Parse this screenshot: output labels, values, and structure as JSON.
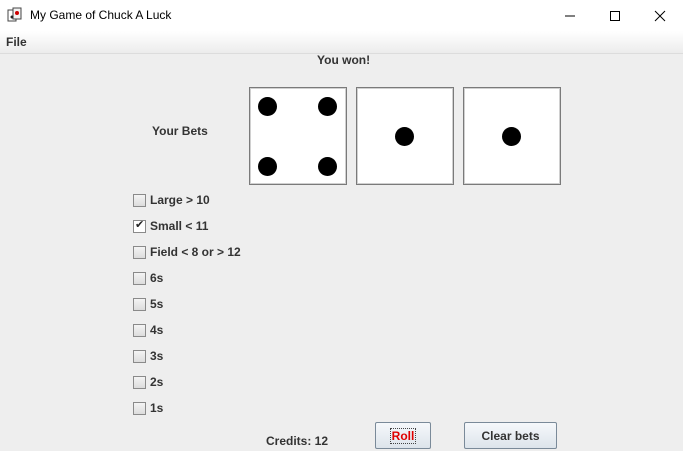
{
  "window": {
    "title": "My Game of Chuck A Luck",
    "app_icon": "chuck-a-luck-icon",
    "controls": [
      "minimize-icon",
      "maximize-icon",
      "close-icon"
    ]
  },
  "menu": {
    "file_label": "File"
  },
  "game": {
    "status": "You won!",
    "bets_label": "Your Bets",
    "dice": [
      4,
      1,
      1
    ],
    "credits_text": "Credits: 12"
  },
  "bets": [
    {
      "label": "Large > 10",
      "checked": false
    },
    {
      "label": "Small < 11",
      "checked": true
    },
    {
      "label": "Field < 8 or > 12",
      "checked": false
    },
    {
      "label": "6s",
      "checked": false
    },
    {
      "label": "5s",
      "checked": false
    },
    {
      "label": "4s",
      "checked": false
    },
    {
      "label": "3s",
      "checked": false
    },
    {
      "label": "2s",
      "checked": false
    },
    {
      "label": "1s",
      "checked": false
    }
  ],
  "buttons": {
    "roll_label": "Roll",
    "clear_label": "Clear bets"
  },
  "colors": {
    "roll_text": "#e00000",
    "window_bg": "#eeeeee"
  }
}
